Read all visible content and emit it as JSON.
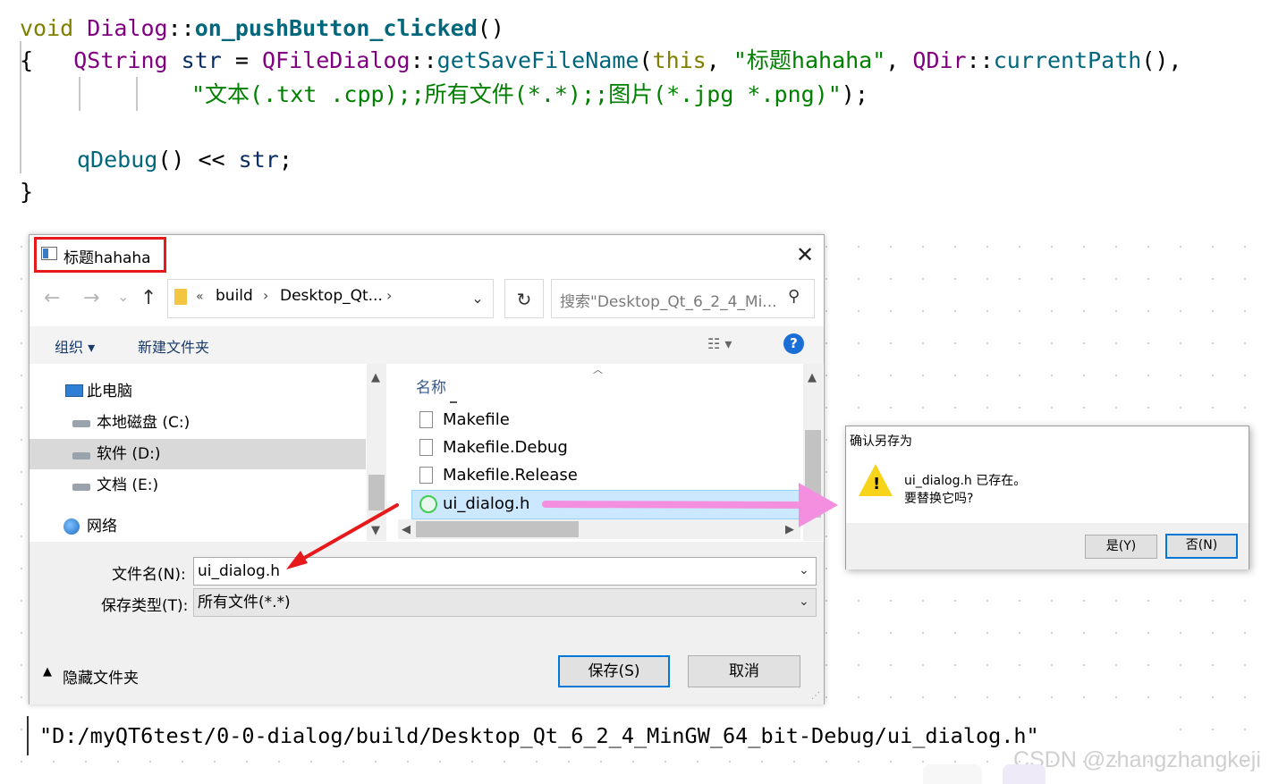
{
  "code": {
    "line1": {
      "kw": "void",
      "cls": "Dialog",
      "sep": "::",
      "fn": "on_pushButton_clicked",
      "paren": "()"
    },
    "line2": {
      "brace": "{",
      "type": "QString",
      "var": "str",
      "eq": "=",
      "cls": "QFileDialog",
      "sep": "::",
      "fn": "getSaveFileName",
      "open": "(",
      "this": "this",
      "comma": ",",
      "title_arg": "\"标题hahaha\"",
      "qdir": "QDir",
      "sep2": "::",
      "fn2": "currentPath",
      "call": "(),",
      "filter": "\"文本(.txt .cpp);;所有文件(*.*);;图片(*.jpg *.png)\"",
      "close": ");"
    },
    "line4": {
      "fn": "qDebug",
      "call": "()",
      "op": "<<",
      "var": "str",
      "semi": ";"
    },
    "line5": {
      "brace": "}"
    }
  },
  "file_dialog": {
    "title": "标题hahaha",
    "close_icon": "close-icon",
    "nav": {
      "back": "←",
      "forward": "→",
      "recent": "⌄",
      "up": "↑"
    },
    "breadcrumb": {
      "prefix": "«",
      "items": [
        "build",
        "Desktop_Qt..."
      ],
      "sep": "›"
    },
    "refresh_icon": "↻",
    "search_placeholder": "搜索\"Desktop_Qt_6_2_4_Mi...",
    "toolbar": {
      "organize": "组织 ▾",
      "new_folder": "新建文件夹",
      "view": "☷ ▾",
      "help": "?"
    },
    "nav_items": [
      "此电脑",
      "本地磁盘 (C:)",
      "软件 (D:)",
      "文档 (E:)",
      "网络"
    ],
    "column_name": "名称",
    "files": [
      "Makefile",
      "Makefile.Debug",
      "Makefile.Release",
      "ui_dialog.h"
    ],
    "filename_label": "文件名(N):",
    "filename_value": "ui_dialog.h",
    "filetype_label": "保存类型(T):",
    "filetype_value": "所有文件(*.*)",
    "hide_folders": "隐藏文件夹",
    "save_button": "保存(S)",
    "cancel_button": "取消"
  },
  "confirm": {
    "title": "确认另存为",
    "message_line1": "ui_dialog.h 已存在。",
    "message_line2": "要替换它吗?",
    "yes_button": "是(Y)",
    "no_button": "否(N)"
  },
  "output": "\"D:/myQT6test/0-0-dialog/build/Desktop_Qt_6_2_4_MinGW_64_bit-Debug/ui_dialog.h\"",
  "watermark": "CSDN @zhangzhangkeji",
  "colors": {
    "highlight_box": "#e8191a",
    "red_arrow": "#e8191a",
    "pink_arrow": "#f48fe0",
    "selection": "#cce8ff",
    "accent": "#0078d7"
  }
}
